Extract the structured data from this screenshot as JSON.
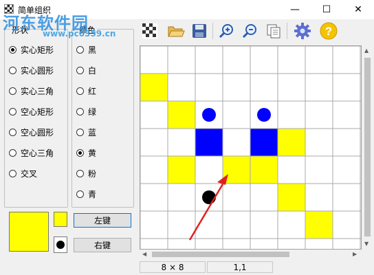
{
  "window": {
    "title": "简单组织"
  },
  "watermark": {
    "text": "河东软件园",
    "url": "www.pc0359.cn"
  },
  "toolbar": {
    "buttons": [
      "checker-icon",
      "open-folder-icon",
      "save-disk-icon",
      "zoom-in-icon",
      "zoom-out-icon",
      "copy-pages-icon",
      "settings-gear-icon",
      "help-icon"
    ]
  },
  "shape_group": {
    "label": "形状",
    "options": [
      "实心矩形",
      "实心圆形",
      "实心三角",
      "空心矩形",
      "空心圆形",
      "空心三角",
      "交叉"
    ],
    "selected": "实心矩形"
  },
  "color_group": {
    "label": "颜色",
    "options": [
      "黑",
      "白",
      "红",
      "绿",
      "蓝",
      "黄",
      "粉",
      "青"
    ],
    "selected": "黄"
  },
  "buttons": {
    "left": "左键",
    "right": "右键"
  },
  "colors": {
    "yellow": "#ffff00",
    "blue": "#0000ff",
    "black": "#000000",
    "arrow": "#e02020",
    "grid": "#a8a8a8"
  },
  "grid": {
    "yellow_cells": [
      [
        0,
        1
      ],
      [
        1,
        2
      ],
      [
        5,
        3
      ],
      [
        3,
        4
      ],
      [
        1,
        4
      ],
      [
        4,
        4
      ],
      [
        5,
        5
      ],
      [
        6,
        6
      ]
    ],
    "blue_cells": [
      [
        2,
        3
      ],
      [
        4,
        3
      ]
    ],
    "circles": [
      {
        "col": 2,
        "row": 2,
        "color": "blue"
      },
      {
        "col": 4,
        "row": 2,
        "color": "blue"
      },
      {
        "col": 2,
        "row": 5,
        "color": "black"
      }
    ]
  },
  "status": {
    "size": "8 × 8",
    "position": "1,1"
  }
}
